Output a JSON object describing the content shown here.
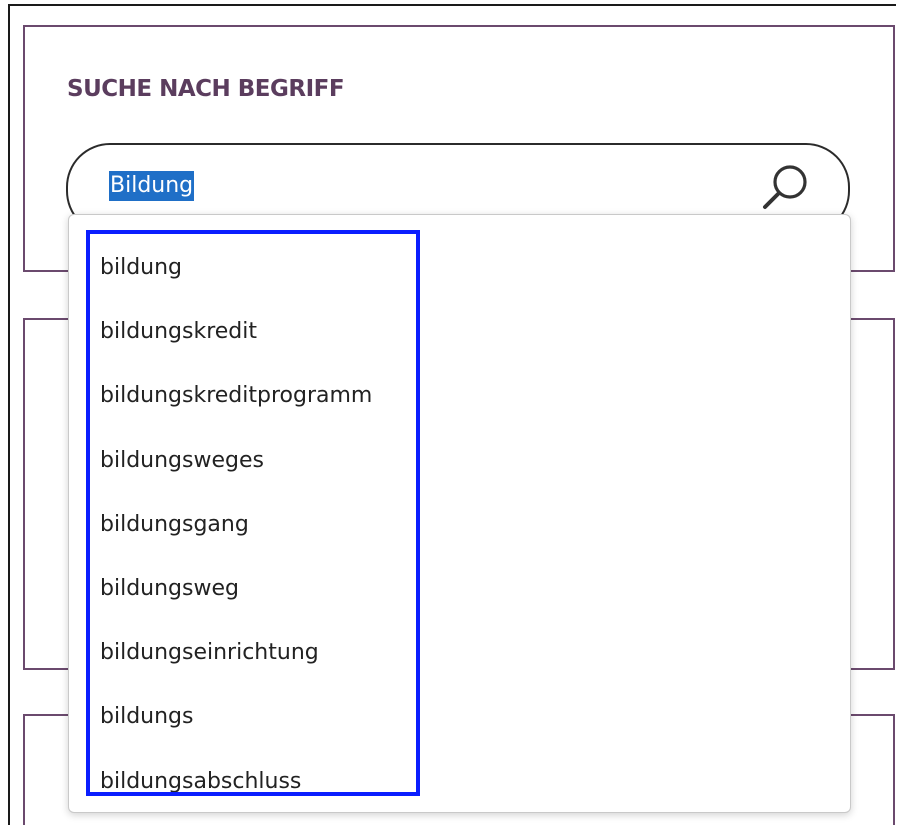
{
  "search_section": {
    "title": "SUCHE NACH BEGRIFF",
    "input_value": "Bildung",
    "search_icon": "magnifier-icon"
  },
  "suggestions": [
    "bildung",
    "bildungskredit",
    "bildungskreditprogramm",
    "bildungsweges",
    "bildungsgang",
    "bildungsweg",
    "bildungseinrichtung",
    "bildungs",
    "bildungsabschluss"
  ],
  "colors": {
    "accent_purple": "#5b3d5e",
    "panel_border": "#6b4a6e",
    "selection_blue": "#1f6fc7",
    "highlight_frame": "#0a1eff"
  }
}
